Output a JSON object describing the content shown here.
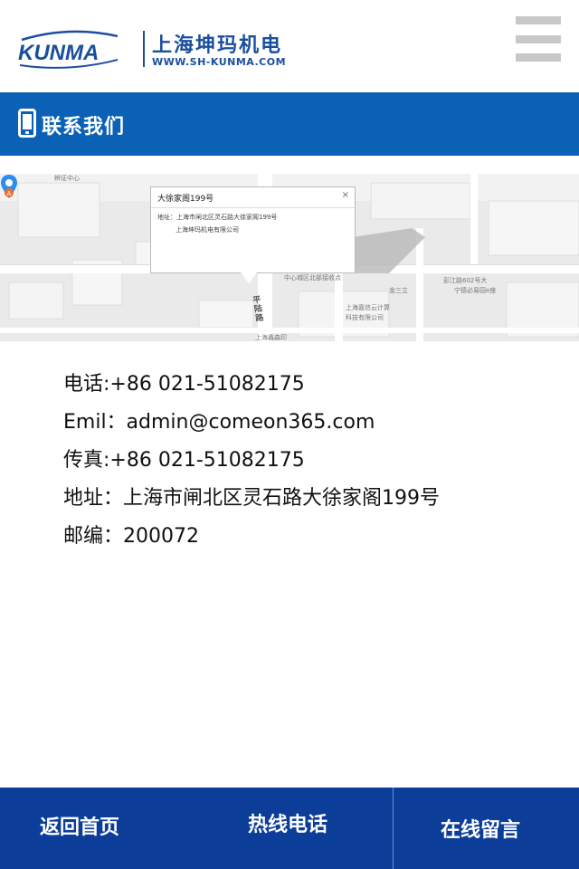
{
  "header": {
    "logo_brand": "KUNMA",
    "logo_cn": "上海坤玛机电",
    "logo_url": "WWW.SH-KUNMA.COM",
    "menu_icon": "hamburger-menu-icon"
  },
  "section": {
    "title": "联系我们",
    "icon": "mobile-phone-icon"
  },
  "map": {
    "popup_title": "大徐家阁199号",
    "popup_close": "×",
    "popup_address": "地址：上海市闸北区灵石路大徐家阁199号",
    "popup_company": "上海坤玛机电有限公司",
    "labels": {
      "l1": "中心城区北部接收点",
      "l2": "彭江路602号大",
      "l3": "宁德必易园e座",
      "l4": "金三立",
      "l5": "上海嘉信云计算",
      "l6": "科技有限公司",
      "l7": "上海鑫森印",
      "l8": "辨证中心",
      "road": "平陆路"
    },
    "marker_label": "A",
    "marker_color": "#2d8cf0",
    "marker_badge_color": "#ef6c2f"
  },
  "contact": {
    "phone": "电话:+86 021-51082175",
    "email": "Emil：admin@comeon365.com",
    "fax": "传真:+86 021-51082175",
    "address": "地址：上海市闸北区灵石路大徐家阁199号",
    "postcode": "邮编：200072"
  },
  "bottom_nav": {
    "home": "返回首页",
    "hotline": "热线电话",
    "message": "在线留言"
  },
  "colors": {
    "brand_blue": "#0a61b5",
    "nav_blue": "#0c3d98",
    "logo_blue": "#1a4f9e"
  }
}
